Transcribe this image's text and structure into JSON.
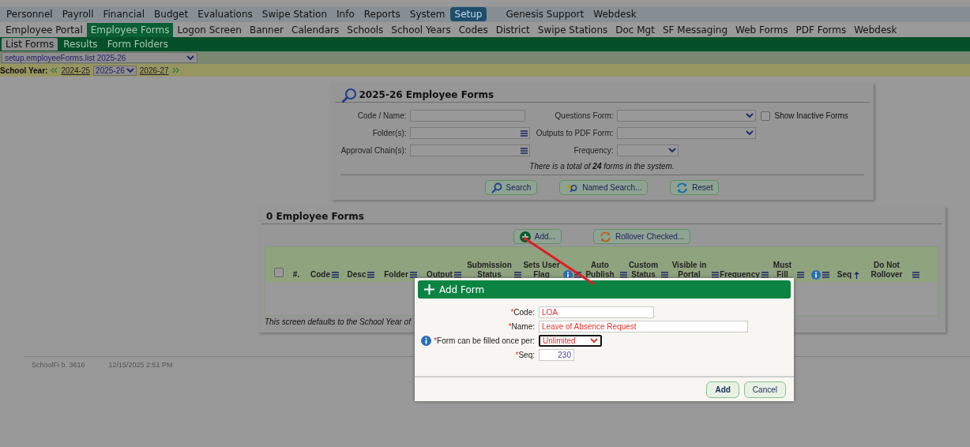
{
  "top_menu": [
    {
      "label": "Personnel",
      "selected": false
    },
    {
      "label": "Payroll",
      "selected": false
    },
    {
      "label": "Financial",
      "selected": false
    },
    {
      "label": "Budget",
      "selected": false
    },
    {
      "label": "Evaluations",
      "selected": false
    },
    {
      "label": "Swipe Station",
      "selected": false
    },
    {
      "label": "Info",
      "selected": false
    },
    {
      "label": "Reports",
      "selected": false
    },
    {
      "label": "System",
      "selected": false
    },
    {
      "label": "Setup",
      "selected": true
    },
    {
      "label": "Genesis Support",
      "selected": false
    },
    {
      "label": "Webdesk",
      "selected": false
    }
  ],
  "sub_menu": [
    {
      "label": "Employee Portal",
      "selected": false
    },
    {
      "label": "Employee Forms",
      "selected": true
    },
    {
      "label": "Logon Screen",
      "selected": false
    },
    {
      "label": "Banner",
      "selected": false
    },
    {
      "label": "Calendars",
      "selected": false
    },
    {
      "label": "Schools",
      "selected": false
    },
    {
      "label": "School Years",
      "selected": false
    },
    {
      "label": "Codes",
      "selected": false
    },
    {
      "label": "District",
      "selected": false
    },
    {
      "label": "Swipe Stations",
      "selected": false
    },
    {
      "label": "Doc Mgt",
      "selected": false
    },
    {
      "label": "SF Messaging",
      "selected": false
    },
    {
      "label": "Web Forms",
      "selected": false
    },
    {
      "label": "PDF Forms",
      "selected": false
    },
    {
      "label": "Webdesk",
      "selected": false
    }
  ],
  "section_tabs": [
    {
      "label": "List Forms",
      "selected": true
    },
    {
      "label": "Results",
      "selected": false
    },
    {
      "label": "Form Folders",
      "selected": false
    }
  ],
  "page_select": {
    "value": "setup.employeeForms.list 2025-26"
  },
  "school_year": {
    "label": "School Year:",
    "previous": "2024-25",
    "current": "2025-26",
    "next": "2026-27"
  },
  "search_panel": {
    "title": "2025-26 Employee Forms",
    "left_fields": [
      {
        "label": "Code / Name:",
        "kind": "text"
      },
      {
        "label": "Folder(s):",
        "kind": "list"
      },
      {
        "label": "Approval Chain(s):",
        "kind": "list"
      }
    ],
    "right_fields": [
      {
        "label": "Questions Form:",
        "kind": "select"
      },
      {
        "label": "Outputs to PDF Form:",
        "kind": "select"
      },
      {
        "label": "Frequency:",
        "kind": "select"
      }
    ],
    "inactive": {
      "label": "Show Inactive Forms",
      "checked": false
    },
    "total_note": "There is a total of **24** forms in the system.",
    "buttons": [
      {
        "label": "Search",
        "kind": "search"
      },
      {
        "label": "Named Search...",
        "kind": "named"
      },
      {
        "label": "Reset",
        "kind": "reset"
      }
    ]
  },
  "forms_panel": {
    "title": "0 Employee Forms",
    "buttons": [
      {
        "label": "Add...",
        "kind": "add"
      },
      {
        "label": "Rollover Checked...",
        "kind": "rollover"
      }
    ],
    "select_all": {
      "checked": false
    },
    "columns": [
      {
        "label": "#.",
        "menu": false
      },
      {
        "label": "Code",
        "menu": true
      },
      {
        "label": "Desc",
        "menu": true
      },
      {
        "label": "Folder",
        "menu": true
      },
      {
        "label": "Output",
        "menu": true
      },
      {
        "label": "Submission Status",
        "menu": true
      },
      {
        "label": "Sets User Flag",
        "info": true,
        "menu": true
      },
      {
        "label": "Auto Publish",
        "menu": true
      },
      {
        "label": "Custom Status",
        "menu": true
      },
      {
        "label": "Visible in Portal",
        "menu": true
      },
      {
        "label": "Frequency",
        "menu": true
      },
      {
        "label": "Must Fill",
        "menu": true
      },
      {
        "info": true,
        "menu": true
      },
      {
        "label": "Seq",
        "menu": false,
        "sorted_ascending": true
      },
      {
        "label": "Do Not Rollover",
        "menu": true
      }
    ],
    "footnote": "This screen defaults to the School Year of"
  },
  "footer": {
    "build": "SchoolFi b. 3616",
    "timestamp": "12/15/2025 2:51 PM"
  },
  "dialog": {
    "title": "Add Form",
    "fields": [
      {
        "required_mark": "*",
        "label": "Code:",
        "kind": "text",
        "value": "LOA"
      },
      {
        "required_mark": "*",
        "label": "Name:",
        "kind": "text",
        "value": "Leave of Absence Request"
      },
      {
        "required_mark": "*",
        "label": "Form can be filled once per:",
        "kind": "select",
        "info": true,
        "value": "Unlimited"
      },
      {
        "required_mark": "*",
        "label": "Seq:",
        "kind": "number",
        "value": "230"
      }
    ],
    "buttons": [
      {
        "label": "Add",
        "primary": true
      },
      {
        "label": "Cancel",
        "primary": false
      }
    ]
  }
}
